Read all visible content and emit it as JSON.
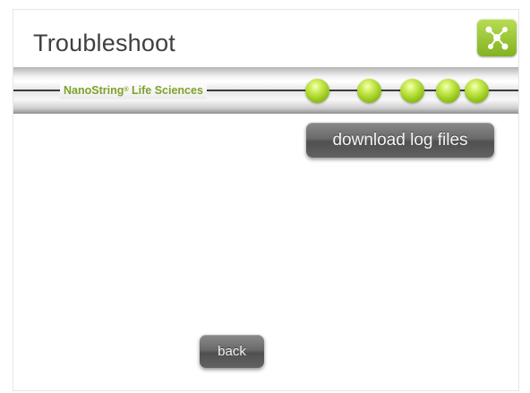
{
  "header": {
    "title": "Troubleshoot",
    "home_icon": "network-nodes-icon"
  },
  "banner": {
    "brand": "NanoString",
    "brand_mark": "®",
    "brand_suffix": " Life Sciences",
    "status_lights": 5,
    "accent_color": "#9bcb1f"
  },
  "actions": {
    "download_label": "download log files",
    "back_label": "back"
  }
}
